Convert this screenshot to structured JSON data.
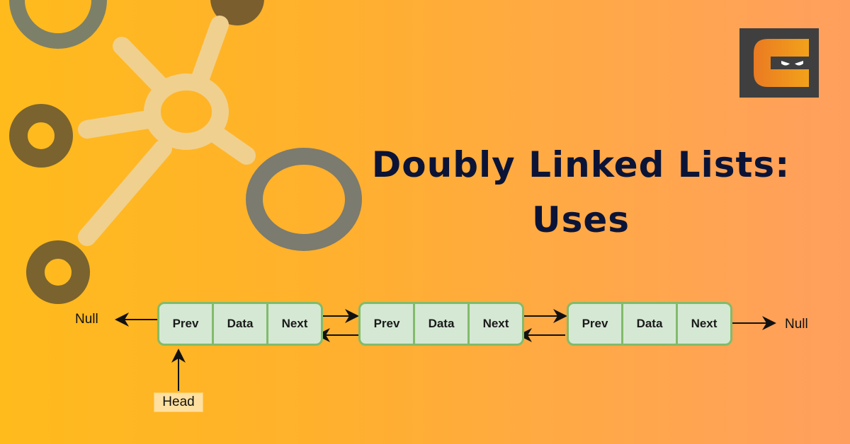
{
  "title": {
    "line1": "Doubly Linked Lists:",
    "line2": "Uses"
  },
  "logo": {
    "icon": "coding-ninjas-logo-icon"
  },
  "colors": {
    "title": "#0b1437",
    "node_fill": "#d5e8d4",
    "node_border": "#82bb6a",
    "logo_bg": "#3f3f3f"
  },
  "diagram": {
    "nodes": [
      {
        "cells": [
          "Prev",
          "Data",
          "Next"
        ]
      },
      {
        "cells": [
          "Prev",
          "Data",
          "Next"
        ]
      },
      {
        "cells": [
          "Prev",
          "Data",
          "Next"
        ]
      }
    ],
    "left_null": "Null",
    "right_null": "Null",
    "head_label": "Head"
  }
}
